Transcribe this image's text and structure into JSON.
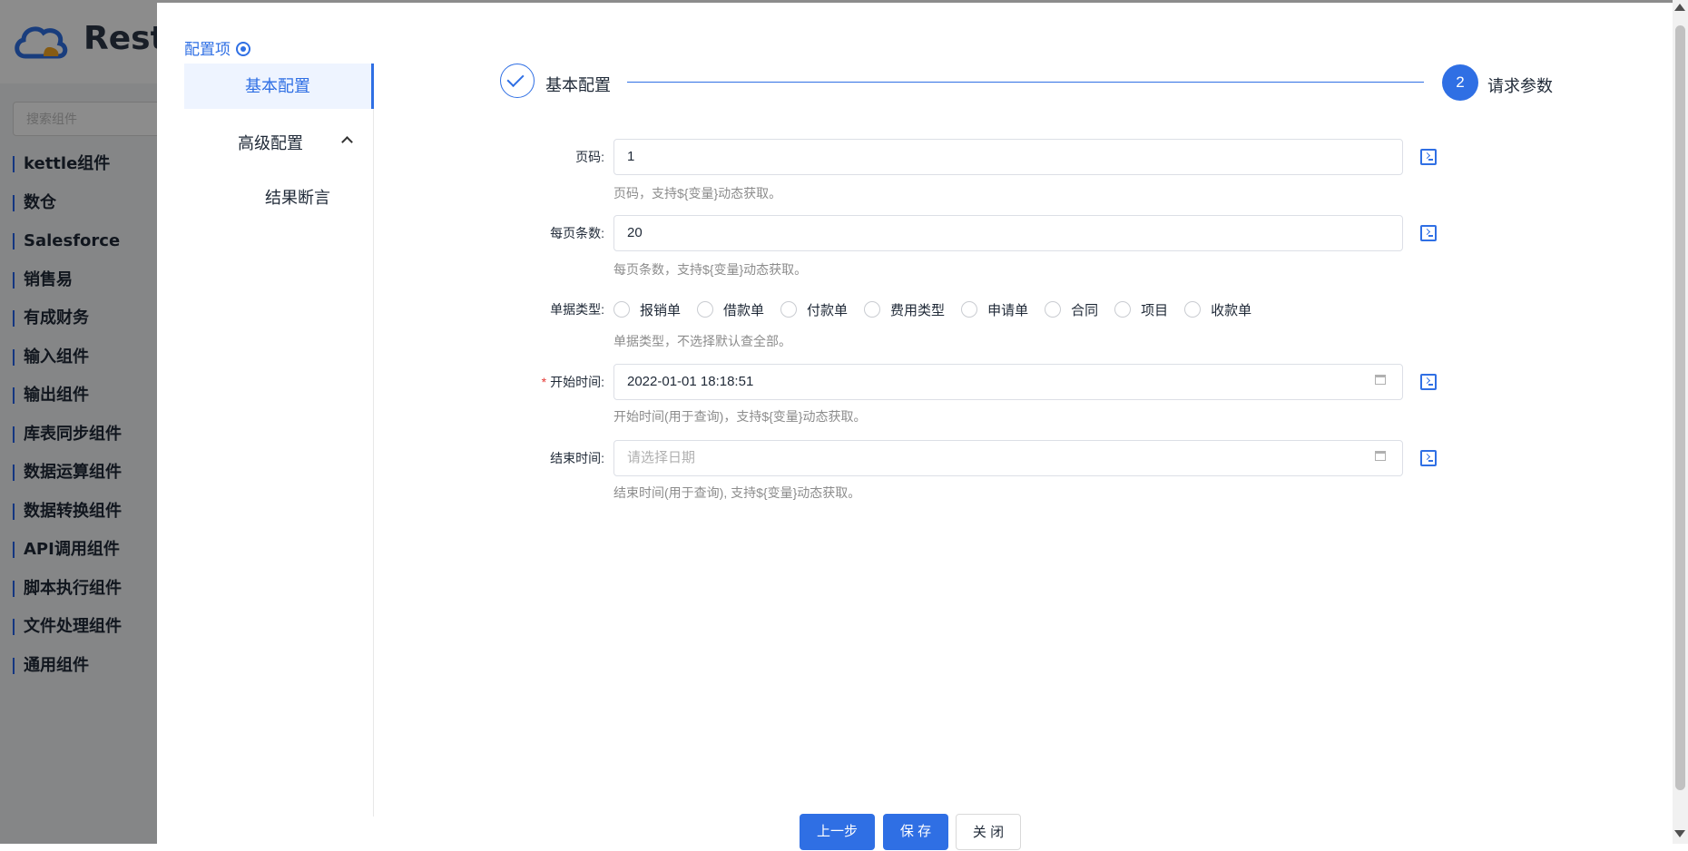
{
  "background": {
    "brand": "Rest",
    "search_placeholder": "搜索组件",
    "menu": [
      "kettle组件",
      "数仓",
      "Salesforce",
      "销售易",
      "有成财务",
      "输入组件",
      "输出组件",
      "库表同步组件",
      "数据运算组件",
      "数据转换组件",
      "API调用组件",
      "脚本执行组件",
      "文件处理组件",
      "通用组件"
    ]
  },
  "nav": {
    "title": "配置项",
    "items": {
      "basic": "基本配置",
      "advanced": "高级配置",
      "assert": "结果断言"
    }
  },
  "steps": [
    {
      "label": "基本配置",
      "status": "done"
    },
    {
      "index": "2",
      "label": "请求参数",
      "status": "current"
    }
  ],
  "form": {
    "page": {
      "label": "页码:",
      "value": "1",
      "hint": "页码，支持${变量}动态获取。"
    },
    "page_size": {
      "label": "每页条数:",
      "value": "20",
      "hint": "每页条数，支持${变量}动态获取。"
    },
    "doc_type": {
      "label": "单据类型:",
      "options": [
        "报销单",
        "借款单",
        "付款单",
        "费用类型",
        "申请单",
        "合同",
        "项目",
        "收款单"
      ],
      "hint": "单据类型，不选择默认查全部。"
    },
    "start_time": {
      "label": "开始时间:",
      "value": "2022-01-01 18:18:51",
      "hint": "开始时间(用于查询)，支持${变量}动态获取。"
    },
    "end_time": {
      "label": "结束时间:",
      "placeholder": "请选择日期",
      "hint": "结束时间(用于查询), 支持${变量}动态获取。"
    }
  },
  "buttons": {
    "prev": "上一步",
    "save": "保 存",
    "close": "关 闭"
  },
  "colors": {
    "accent": "#2f6fe4",
    "required": "#e53935"
  }
}
